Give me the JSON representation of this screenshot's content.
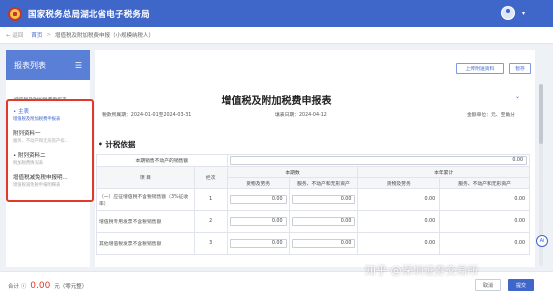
{
  "app": {
    "title": "国家税务总局湖北省电子税务局"
  },
  "breadcrumb": {
    "back": "← 返回",
    "home": "首页",
    "sep": ">",
    "current": "增值税及附加税费申报（小规模纳税人）"
  },
  "sidebar": {
    "title": "报表列表",
    "faded_label": "增值税及附加税费申报表",
    "items": [
      {
        "title": "• 主表",
        "sub": "增值税及附加税费申报表"
      },
      {
        "title": "附列资料一",
        "sub": "服务、不动产和无形资产扣..."
      },
      {
        "title": "• 附列资料二",
        "sub": "附加税费情况表"
      },
      {
        "title": "增值税减免税申报明...",
        "sub": "增值税减免税申报明细表"
      }
    ]
  },
  "toolbar": {
    "upload_label": "上传附送资料",
    "save_label": "暂存"
  },
  "form": {
    "title": "增值税及附加税费申报表",
    "period": "税款所属期：2024-01-01至2024-03-31",
    "fill_date": "填表日期：2024-04-12",
    "unit": "金额单位：元、至角分",
    "section_title": "计税依据"
  },
  "table": {
    "top_row": {
      "label": "本期销售不动产的销售额",
      "value": "0.00"
    },
    "headers": {
      "item": "项  目",
      "col": "栏次",
      "current": "本期数",
      "ytd": "本年累计",
      "goods": "货物及劳务",
      "services": "服务、不动产和无形资产"
    },
    "rows": [
      {
        "label": "（一）应征增值税不含税销售额（3%征收率）",
        "col": "1",
        "v1": "0.00",
        "v2": "0.00",
        "v3": "0.00",
        "v4": "0.00"
      },
      {
        "label": "增值税专用发票不含税销售额",
        "col": "2",
        "v1": "0.00",
        "v2": "0.00",
        "v3": "0.00",
        "v4": "0.00"
      },
      {
        "label": "其他增值税发票不含税销售额",
        "col": "3",
        "v1": "0.00",
        "v2": "0.00",
        "v3": "0.00",
        "v4": "0.00"
      }
    ]
  },
  "footer": {
    "total_label": "合计 ⓘ",
    "amount": "0.00",
    "unit": "元（零元整）",
    "cancel": "取消",
    "submit": "提交"
  },
  "badge": "Ai",
  "watermark": "知乎 @深圳证券交易所",
  "colors": {
    "brand": "#3f66c9",
    "highlight": "#e23a2a"
  }
}
